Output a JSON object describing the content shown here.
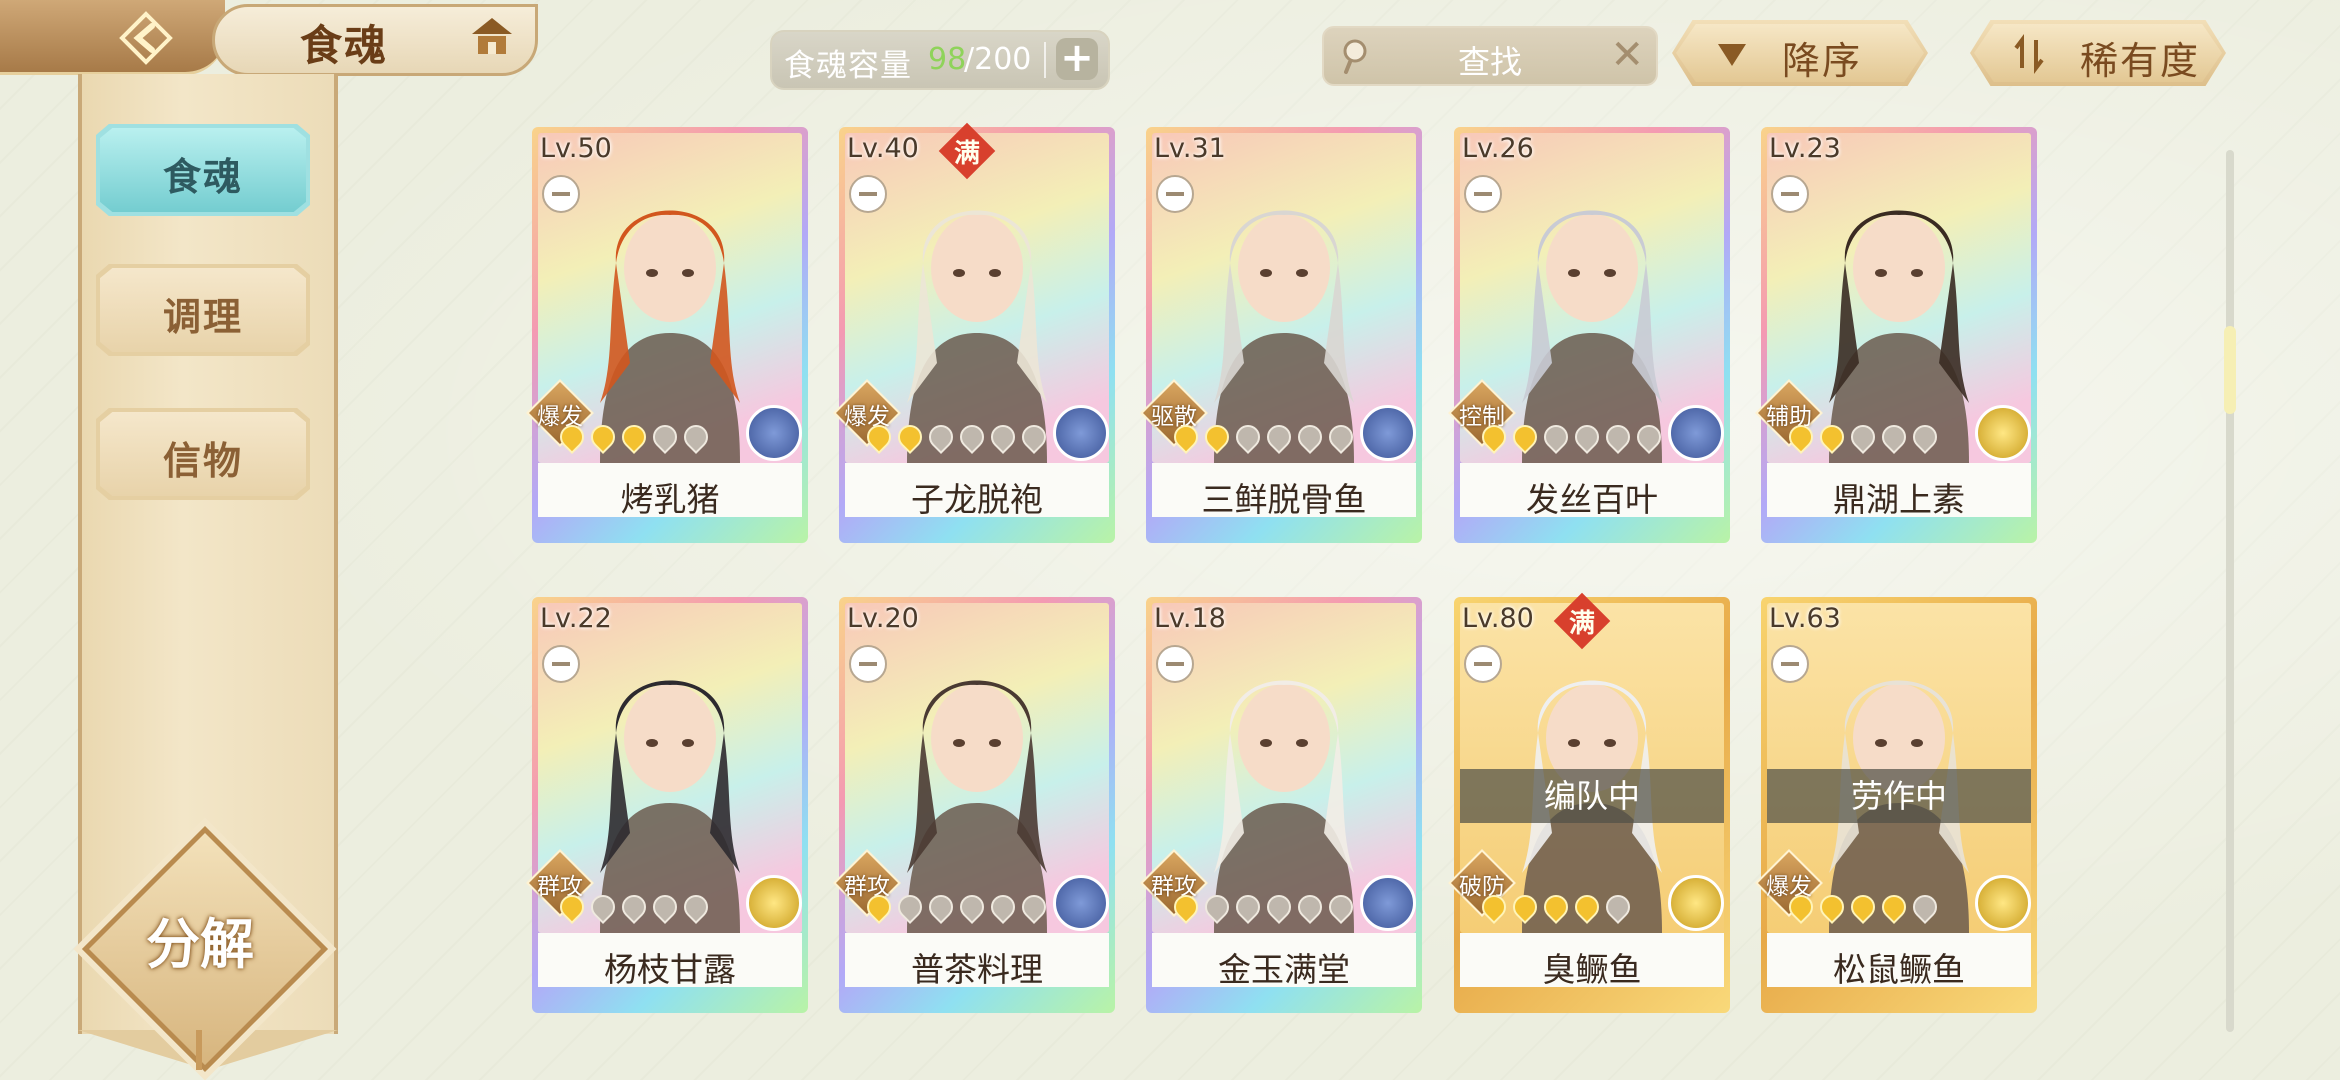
{
  "header": {
    "title": "食魂",
    "capacity_label": "食魂容量",
    "capacity_current": "98",
    "capacity_max": "/200",
    "add_label": "+",
    "search_placeholder": "查找",
    "search_clear": "✕",
    "sort_order_label": "降序",
    "sort_key_label": "稀有度"
  },
  "sidebar": {
    "tabs": [
      {
        "label": "食魂",
        "active": true
      },
      {
        "label": "调理",
        "active": false
      },
      {
        "label": "信物",
        "active": false
      }
    ],
    "decompose_label": "分解"
  },
  "colors": {
    "capacity_current": "#8fd35a",
    "active_tab": "#74cdd0",
    "full_badge": "#d8402d"
  },
  "cards": [
    {
      "level": "Lv.50",
      "name": "烤乳猪",
      "role": "爆发",
      "stars": 3,
      "max_stars": 5,
      "frame": "rainbow",
      "element": "blue",
      "full": false,
      "status": "",
      "hair": "#d2561e"
    },
    {
      "level": "Lv.40",
      "name": "子龙脱袍",
      "role": "爆发",
      "stars": 2,
      "max_stars": 6,
      "frame": "rainbow",
      "element": "blue",
      "full": true,
      "full_label": "满",
      "status": "",
      "hair": "#ece6d6"
    },
    {
      "level": "Lv.31",
      "name": "三鲜脱骨鱼",
      "role": "驱散",
      "stars": 2,
      "max_stars": 6,
      "frame": "rainbow",
      "element": "blue",
      "full": false,
      "status": "",
      "hair": "#d9d6d2"
    },
    {
      "level": "Lv.26",
      "name": "发丝百叶",
      "role": "控制",
      "stars": 2,
      "max_stars": 6,
      "frame": "rainbow",
      "element": "blue",
      "full": false,
      "status": "",
      "hair": "#c9cbd4"
    },
    {
      "level": "Lv.23",
      "name": "鼎湖上素",
      "role": "辅助",
      "stars": 2,
      "max_stars": 5,
      "frame": "rainbow",
      "element": "yellow",
      "full": false,
      "status": "",
      "hair": "#3a2b22"
    },
    {
      "level": "Lv.22",
      "name": "杨枝甘露",
      "role": "群攻",
      "stars": 1,
      "max_stars": 5,
      "frame": "rainbow",
      "element": "yellow",
      "full": false,
      "status": "",
      "hair": "#2d2a2f"
    },
    {
      "level": "Lv.20",
      "name": "普茶料理",
      "role": "群攻",
      "stars": 1,
      "max_stars": 6,
      "frame": "rainbow",
      "element": "blue",
      "full": false,
      "status": "",
      "hair": "#4a3a32"
    },
    {
      "level": "Lv.18",
      "name": "金玉满堂",
      "role": "群攻",
      "stars": 1,
      "max_stars": 6,
      "frame": "rainbow",
      "element": "blue",
      "full": false,
      "status": "",
      "hair": "#f2ede6"
    },
    {
      "level": "Lv.80",
      "name": "臭鳜鱼",
      "role": "破防",
      "stars": 4,
      "max_stars": 5,
      "frame": "gold",
      "element": "yellow",
      "full": true,
      "full_label": "满",
      "status": "编队中",
      "hair": "#efefef"
    },
    {
      "level": "Lv.63",
      "name": "松鼠鳜鱼",
      "role": "爆发",
      "stars": 4,
      "max_stars": 5,
      "frame": "gold",
      "element": "yellow",
      "full": false,
      "status": "劳作中",
      "hair": "#e8e2d6"
    }
  ]
}
